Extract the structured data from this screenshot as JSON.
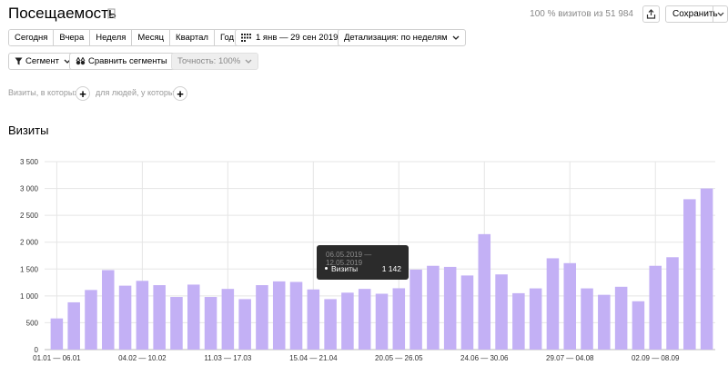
{
  "header": {
    "title": "Посещаемость",
    "summary": "100 % визитов из 51 984",
    "save_label": "Сохранить"
  },
  "periods": [
    "Сегодня",
    "Вчера",
    "Неделя",
    "Месяц",
    "Квартал",
    "Год"
  ],
  "date_range": "1 янв — 29 сен 2019",
  "detail": "Детализация: по неделям",
  "segment_label": "Сегмент",
  "compare_label": "Сравнить сегменты",
  "accuracy_label": "Точность: 100%",
  "filters": {
    "visits_label": "Визиты, в которых",
    "people_label": "для людей, у которых"
  },
  "section_title": "Визиты",
  "tooltip": {
    "range": "06.05.2019 — 12.05.2019",
    "name": "Визиты",
    "value": "1 142"
  },
  "colors": {
    "bar": "#c3b0f5",
    "tooltip_bg": "#2b2b2b",
    "grid": "#e5e5e5"
  },
  "chart_data": {
    "type": "bar",
    "ylim": [
      0,
      3500
    ],
    "yticks": [
      0,
      500,
      1000,
      1500,
      2000,
      2500,
      3000,
      3500
    ],
    "ytick_labels": [
      "0",
      "500",
      "1 000",
      "1 500",
      "2 000",
      "2 500",
      "3 000",
      "3 500"
    ],
    "xtick_labels": [
      {
        "index": 0,
        "label": "01.01 — 06.01"
      },
      {
        "index": 5,
        "label": "04.02 — 10.02"
      },
      {
        "index": 10,
        "label": "11.03 — 17.03"
      },
      {
        "index": 15,
        "label": "15.04 — 21.04"
      },
      {
        "index": 20,
        "label": "20.05 — 26.05"
      },
      {
        "index": 25,
        "label": "24.06 — 30.06"
      },
      {
        "index": 30,
        "label": "29.07 — 04.08"
      },
      {
        "index": 35,
        "label": "02.09 — 08.09"
      }
    ],
    "series": [
      {
        "name": "Визиты",
        "values": [
          580,
          880,
          1110,
          1480,
          1190,
          1280,
          1200,
          980,
          1210,
          980,
          1130,
          940,
          1200,
          1270,
          1260,
          1120,
          940,
          1060,
          1130,
          1040,
          1142,
          1490,
          1560,
          1540,
          1380,
          2150,
          1400,
          1050,
          1140,
          1700,
          1610,
          1140,
          1020,
          1170,
          900,
          1560,
          1720,
          2800,
          3000
        ]
      }
    ]
  }
}
